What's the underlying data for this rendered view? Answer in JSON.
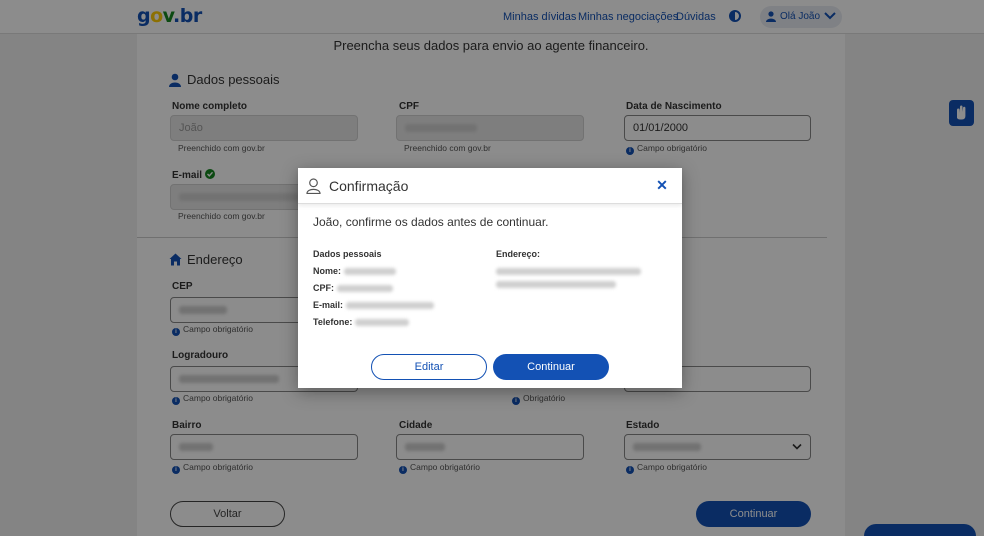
{
  "header": {
    "nav": [
      "Minhas dívidas",
      "Minhas negociações",
      "Dúvidas"
    ],
    "user_label": "Olá João",
    "accent": "#1351b4"
  },
  "page": {
    "intro": "Preencha seus dados para envio ao agente financeiro.",
    "personal": {
      "title": "Dados pessoais",
      "name_label": "Nome completo",
      "name_value": "João",
      "cpf_label": "CPF",
      "birth_label": "Data de Nascimento",
      "birth_value": "01/01/2000",
      "prefilled": "Preenchido com gov.br",
      "required": "Campo obrigatório",
      "email_label": "E-mail"
    },
    "address": {
      "title": "Endereço",
      "cep_label": "CEP",
      "street_label": "Logradouro",
      "neighborhood_label": "Bairro",
      "city_label": "Cidade",
      "state_label": "Estado",
      "required": "Campo obrigatório",
      "required_short": "Obrigatório"
    },
    "back_button": "Voltar",
    "continue_button": "Continuar"
  },
  "modal": {
    "title": "Confirmação",
    "subtitle": "João, confirme os dados antes de continuar.",
    "personal_title": "Dados pessoais",
    "name_label": "Nome:",
    "cpf_label": "CPF:",
    "email_label": "E-mail:",
    "phone_label": "Telefone:",
    "address_title": "Endereço:",
    "edit_button": "Editar",
    "continue_button": "Continuar"
  },
  "icons": [
    "person-icon",
    "home-icon",
    "check-circle-icon",
    "info-icon",
    "close-icon",
    "chevron-down-icon",
    "contrast-icon",
    "hand-sign-icon"
  ]
}
